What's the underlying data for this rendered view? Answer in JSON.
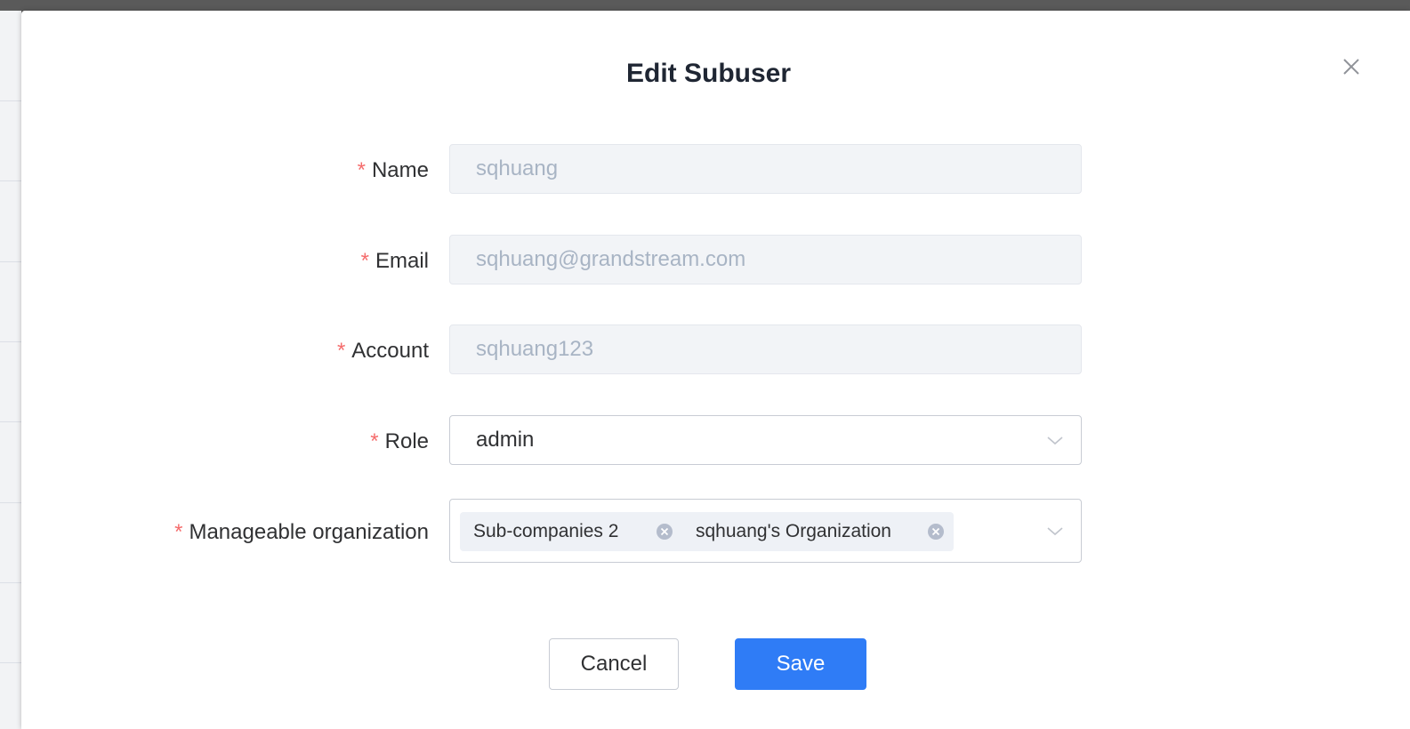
{
  "dialog": {
    "title": "Edit Subuser",
    "close_icon": "close-icon"
  },
  "form": {
    "required_marker": "*",
    "name": {
      "label": "Name",
      "value": "sqhuang",
      "disabled": true
    },
    "email": {
      "label": "Email",
      "value": "sqhuang@grandstream.com",
      "disabled": true
    },
    "account": {
      "label": "Account",
      "value": "sqhuang123",
      "disabled": true
    },
    "role": {
      "label": "Role",
      "value": "admin",
      "icon": "chevron-down-icon"
    },
    "manageable_organization": {
      "label": "Manageable organization",
      "tags": [
        {
          "label": "Sub-companies 2",
          "icon": "tag-close-icon"
        },
        {
          "label": "sqhuang's Organization",
          "icon": "tag-close-icon"
        }
      ],
      "icon": "chevron-down-icon"
    }
  },
  "footer": {
    "cancel_label": "Cancel",
    "save_label": "Save"
  },
  "colors": {
    "primary": "#2f7cf6",
    "required": "#f56c6c",
    "disabled_bg": "#f2f4f7",
    "disabled_text": "#a8b4c4",
    "tag_bg": "#eef1f6"
  }
}
